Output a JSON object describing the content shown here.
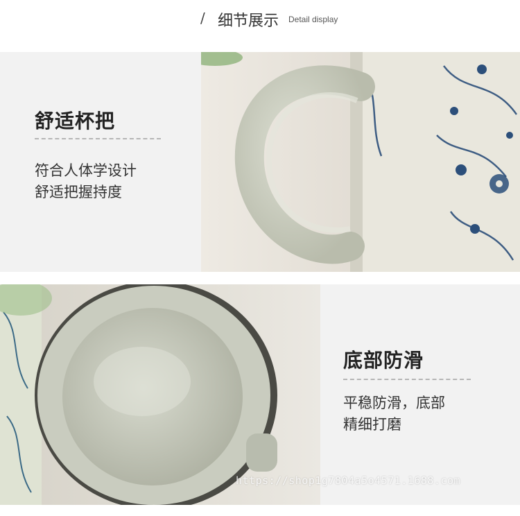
{
  "header": {
    "slash": "/",
    "title_cn": "细节展示",
    "title_en": "Detail display"
  },
  "features": [
    {
      "title": "舒适杯把",
      "desc_line1": "符合人体学设计",
      "desc_line2": "舒适把握持度"
    },
    {
      "title": "底部防滑",
      "desc_line1": "平稳防滑，底部",
      "desc_line2": "精细打磨"
    }
  ],
  "photos": {
    "handle_photo_icon": "mug-handle-photo",
    "bottom_photo_icon": "mug-bottom-photo"
  },
  "watermark": "https://shop1g7804a5o4571.1688.com",
  "colors": {
    "panel_bg": "#f2f2f2",
    "glaze": "#cfd2c4",
    "pattern_blue": "#2c4f7a"
  }
}
